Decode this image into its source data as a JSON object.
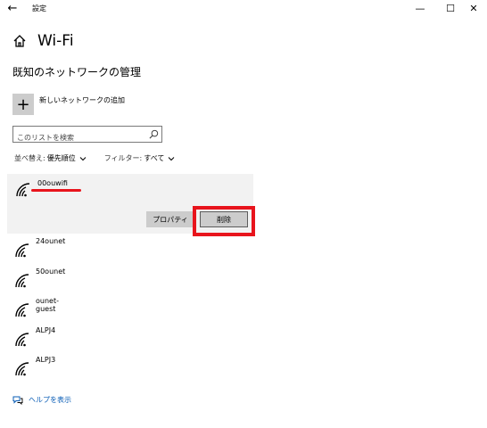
{
  "window": {
    "title": "設定",
    "back_icon": "back-arrow-icon",
    "minimize_glyph": "—",
    "maximize_glyph": "☐",
    "close_glyph": "✕"
  },
  "header": {
    "title": "Wi-Fi",
    "home_icon": "home-icon"
  },
  "section": {
    "title": "既知のネットワークの管理"
  },
  "add_network": {
    "plus": "+",
    "label": "新しいネットワークの追加"
  },
  "search": {
    "placeholder": "このリストを検索"
  },
  "sort": {
    "label": "並べ替え:",
    "value": "優先順位"
  },
  "filter": {
    "label": "フィルター:",
    "value": "すべて"
  },
  "selected_network": {
    "name": "00ouwifi",
    "properties_label": "プロパティ",
    "delete_label": "削除"
  },
  "networks": [
    {
      "name": "24ounet"
    },
    {
      "name": "50ounet"
    },
    {
      "name": "ounet-guest"
    },
    {
      "name": "ALPJ4"
    },
    {
      "name": "ALPJ3"
    }
  ],
  "help": {
    "label": "ヘルプを表示"
  },
  "colors": {
    "highlight": "#e8141c",
    "link": "#0a5db6",
    "panel_bg": "#f2f2f2",
    "button_bg": "#cccccc"
  }
}
